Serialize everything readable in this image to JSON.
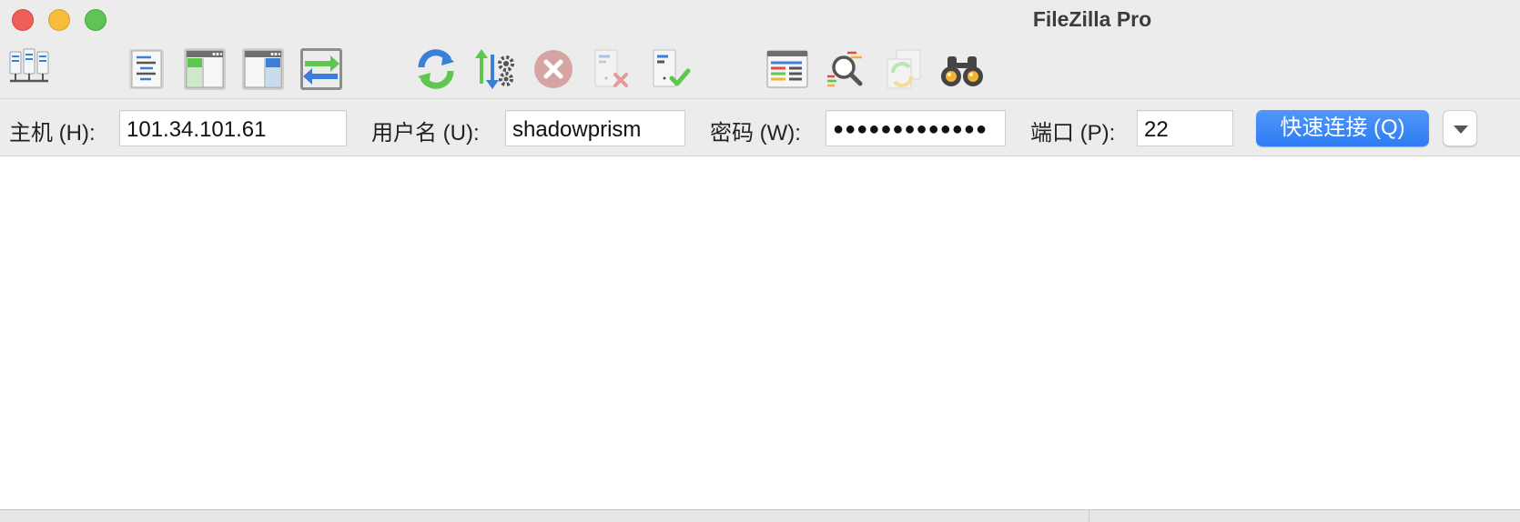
{
  "window": {
    "title": "FileZilla Pro"
  },
  "toolbar": {
    "icons": [
      "site-manager-icon",
      "message-log-icon",
      "local-tree-icon",
      "remote-tree-icon",
      "transfer-queue-icon",
      "refresh-icon",
      "process-queue-icon",
      "cancel-icon",
      "disconnect-icon",
      "reconnect-icon",
      "directory-listing-filter-icon",
      "directory-comparison-icon",
      "synchronized-browsing-icon",
      "search-remote-files-icon"
    ]
  },
  "quickconnect": {
    "host_label": "主机 (H):",
    "host_value": "101.34.101.61",
    "username_label": "用户名 (U):",
    "username_value": "shadowprism",
    "password_label": "密码 (W):",
    "password_value": "●●●●●●●●●●●●●",
    "port_label": "端口 (P):",
    "port_value": "22",
    "connect_button": "快速连接 (Q)"
  },
  "colors": {
    "accent": "#2d7cf2",
    "close": "#ee5f57",
    "minimize": "#f6bd3c",
    "maximize": "#5fc454"
  }
}
